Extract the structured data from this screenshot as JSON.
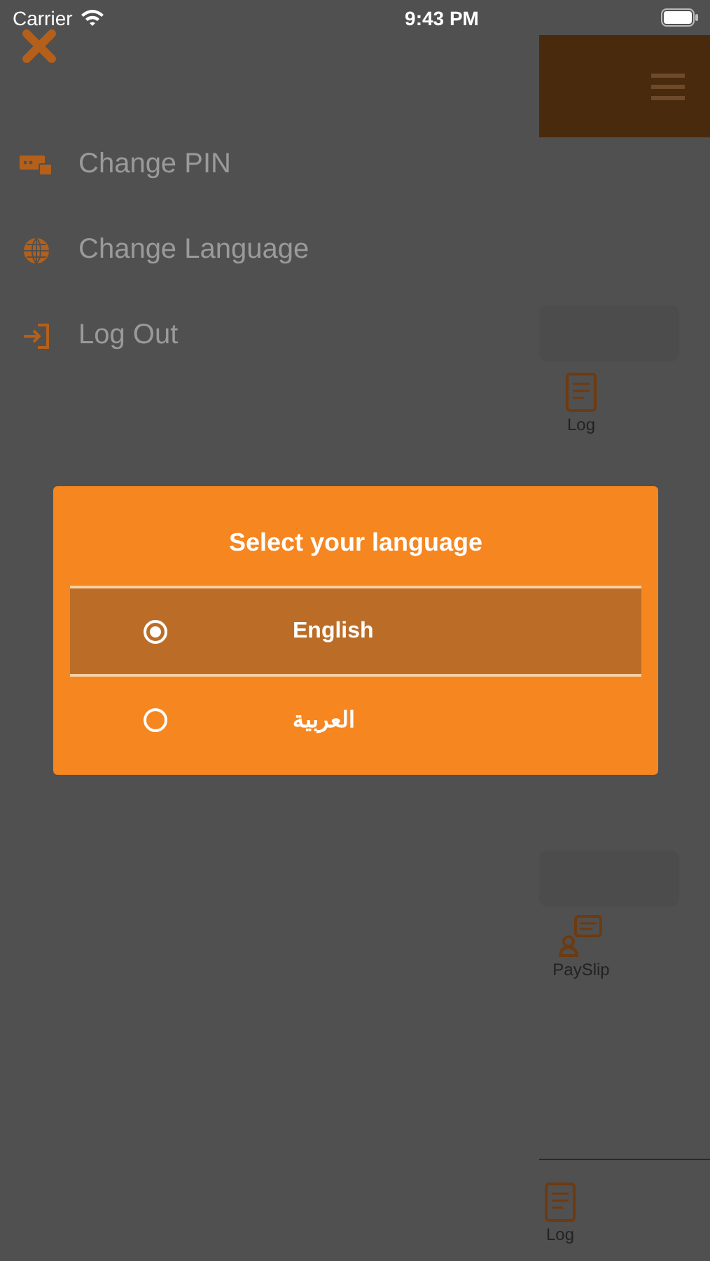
{
  "status_bar": {
    "carrier": "Carrier",
    "time": "9:43 PM"
  },
  "menu": {
    "items": [
      {
        "label": "Change PIN",
        "kind": "pin"
      },
      {
        "label": "Change Language",
        "kind": "globe"
      },
      {
        "label": "Log Out",
        "kind": "logout"
      }
    ]
  },
  "background_app": {
    "tiles": [
      {
        "label": "Log",
        "kind": "log"
      },
      {
        "label": "PaySlip",
        "kind": "payslip"
      }
    ],
    "tab_bar": [
      {
        "label": "Log",
        "kind": "log"
      }
    ]
  },
  "dialog": {
    "title": "Select your language",
    "options": [
      {
        "label": "English",
        "selected": true
      },
      {
        "label": "العربية",
        "selected": false
      }
    ]
  }
}
